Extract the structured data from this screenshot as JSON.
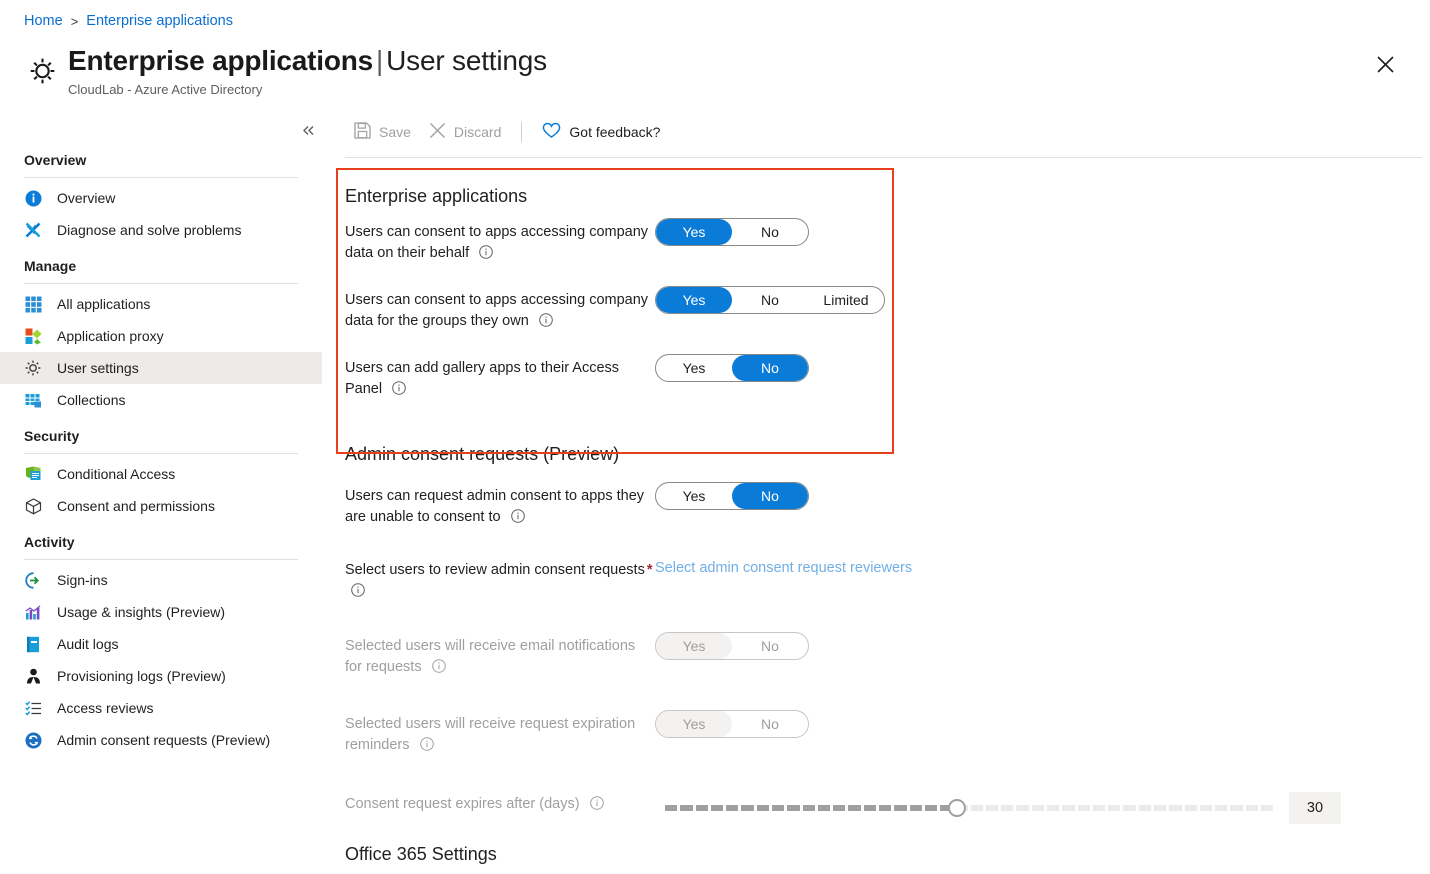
{
  "breadcrumb": {
    "items": [
      {
        "label": "Home"
      },
      {
        "label": "Enterprise applications"
      }
    ],
    "separator": ">"
  },
  "header": {
    "icon": "gear-icon",
    "title_main": "Enterprise applications",
    "title_separator": "|",
    "title_sub": "User settings",
    "subtitle": "CloudLab - Azure Active Directory",
    "close_label": "✕"
  },
  "sidebar": {
    "collapse_label": "«",
    "groups": [
      {
        "title": "Overview",
        "items": [
          {
            "label": "Overview",
            "icon": "info-circle-icon",
            "selected": false
          },
          {
            "label": "Diagnose and solve problems",
            "icon": "wrench-icon",
            "selected": false
          }
        ]
      },
      {
        "title": "Manage",
        "items": [
          {
            "label": "All applications",
            "icon": "grid-apps-icon",
            "selected": false
          },
          {
            "label": "Application proxy",
            "icon": "proxy-icon",
            "selected": false
          },
          {
            "label": "User settings",
            "icon": "gear-icon",
            "selected": true
          },
          {
            "label": "Collections",
            "icon": "collections-icon",
            "selected": false
          }
        ]
      },
      {
        "title": "Security",
        "items": [
          {
            "label": "Conditional Access",
            "icon": "conditional-access-icon",
            "selected": false
          },
          {
            "label": "Consent and permissions",
            "icon": "cube-icon",
            "selected": false
          }
        ]
      },
      {
        "title": "Activity",
        "items": [
          {
            "label": "Sign-ins",
            "icon": "sign-in-arrow-icon",
            "selected": false
          },
          {
            "label": "Usage & insights (Preview)",
            "icon": "bar-chart-icon",
            "selected": false
          },
          {
            "label": "Audit logs",
            "icon": "audit-book-icon",
            "selected": false
          },
          {
            "label": "Provisioning logs (Preview)",
            "icon": "person-icon",
            "selected": false
          },
          {
            "label": "Access reviews",
            "icon": "checklist-icon",
            "selected": false
          },
          {
            "label": "Admin consent requests (Preview)",
            "icon": "sync-circle-icon",
            "selected": false
          }
        ]
      }
    ]
  },
  "toolbar": {
    "save_label": "Save",
    "save_icon": "save-disk-icon",
    "save_disabled": true,
    "discard_label": "Discard",
    "discard_icon": "close-x-icon",
    "discard_disabled": true,
    "feedback_label": "Got feedback?",
    "feedback_icon": "heart-icon"
  },
  "sections": {
    "enterprise_apps": {
      "title": "Enterprise applications",
      "highlighted": true,
      "settings": [
        {
          "label": "Users can consent to apps accessing company data on their behalf",
          "info_icon": "info-icon",
          "options": [
            "Yes",
            "No"
          ],
          "selected": "Yes",
          "disabled": false
        },
        {
          "label": "Users can consent to apps accessing company data for the groups they own",
          "info_icon": "info-icon",
          "options": [
            "Yes",
            "No",
            "Limited"
          ],
          "selected": "Yes",
          "disabled": false
        },
        {
          "label": "Users can add gallery apps to their Access Panel",
          "info_icon": "info-icon",
          "options": [
            "Yes",
            "No"
          ],
          "selected": "No",
          "disabled": false
        }
      ]
    },
    "admin_consent": {
      "title": "Admin consent requests (Preview)",
      "settings": [
        {
          "label": "Users can request admin consent to apps they are unable to consent to",
          "info_icon": "info-icon",
          "options": [
            "Yes",
            "No"
          ],
          "selected": "No",
          "disabled": false
        },
        {
          "label": "Select users to review admin consent requests",
          "required": true,
          "required_marker": "*",
          "info_icon": "info-icon",
          "link_label": "Select admin consent request reviewers"
        },
        {
          "label": "Selected users will receive email notifications for requests",
          "info_icon": "info-icon",
          "options": [
            "Yes",
            "No"
          ],
          "selected": "Yes",
          "disabled": true
        },
        {
          "label": "Selected users will receive request expiration reminders",
          "info_icon": "info-icon",
          "options": [
            "Yes",
            "No"
          ],
          "selected": "Yes",
          "disabled": true
        },
        {
          "label": "Consent request expires after (days)",
          "info_icon": "info-icon",
          "slider": {
            "value": "30",
            "fill_percent": 48,
            "ticks": 40,
            "disabled": true
          }
        }
      ]
    },
    "office365": {
      "title": "Office 365 Settings"
    }
  },
  "colors": {
    "accent_blue": "#0a7cd8",
    "link_blue": "#0a6ed1",
    "link_disabled_blue": "#71afe5",
    "highlight_red": "#e8401f",
    "required_red": "#a4262c",
    "disabled_grey": "#a19f9d",
    "selected_nav_bg": "#edebe9"
  }
}
